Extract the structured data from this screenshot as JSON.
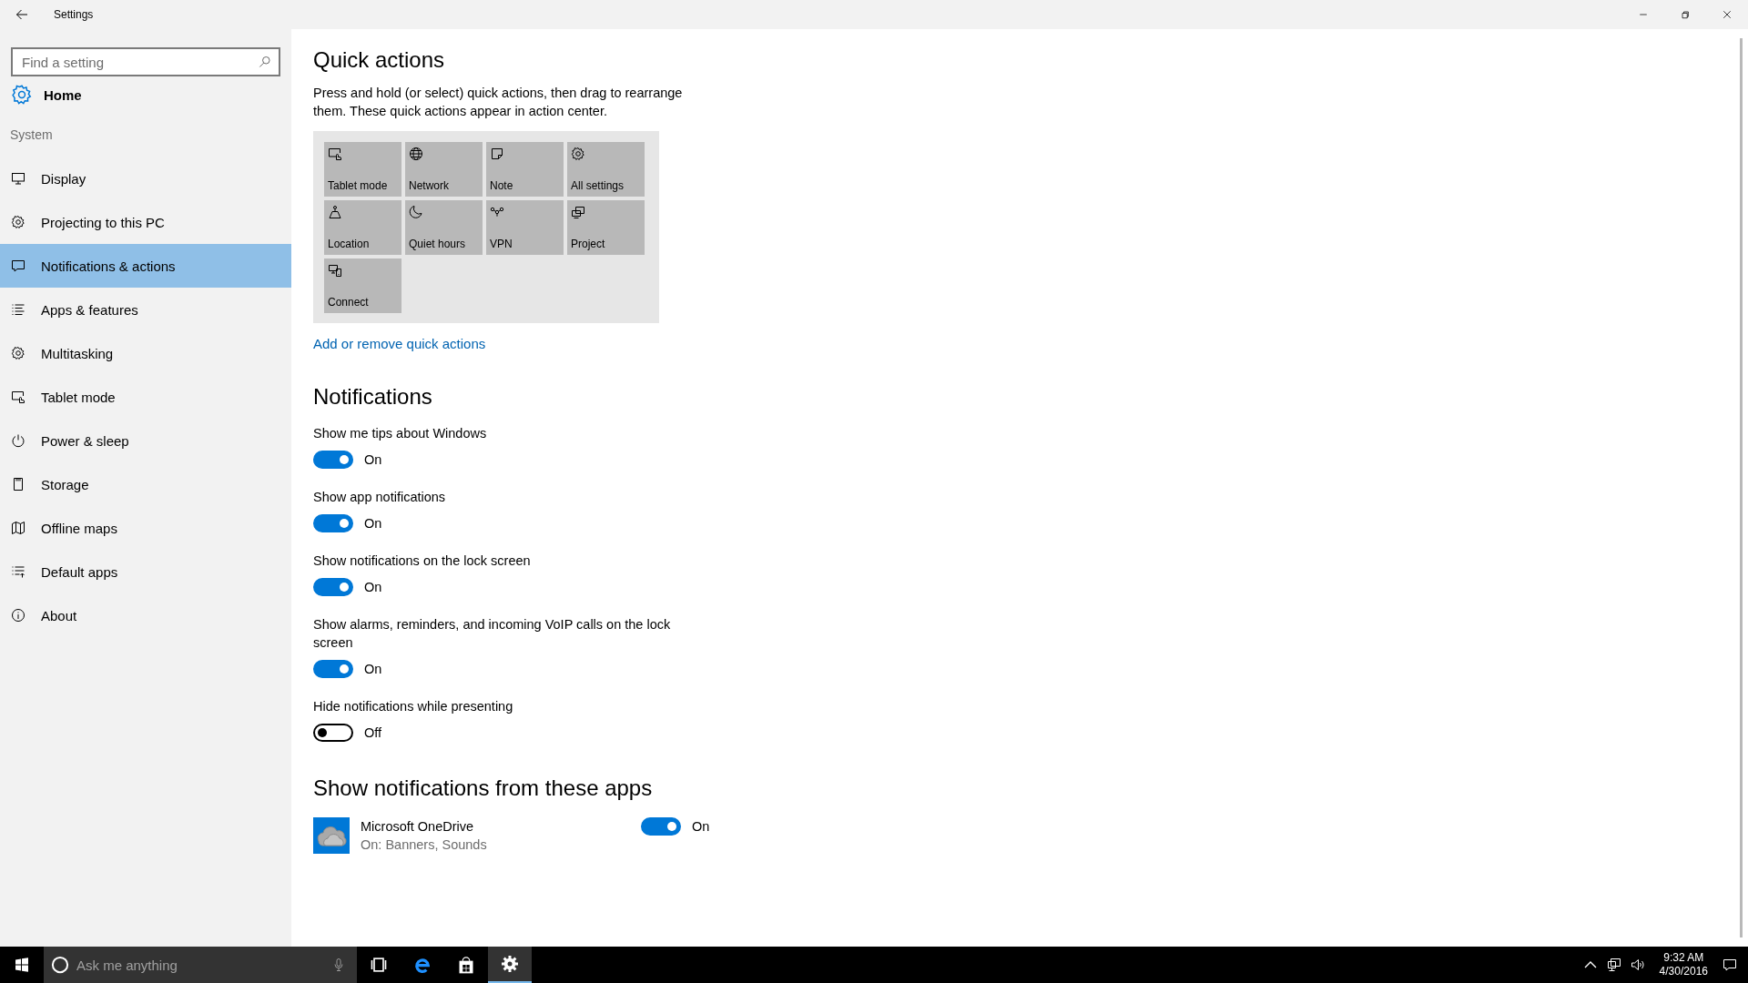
{
  "window": {
    "title": "Settings"
  },
  "search": {
    "placeholder": "Find a setting"
  },
  "home": {
    "label": "Home"
  },
  "sidebar": {
    "section": "System",
    "items": [
      {
        "label": "Display",
        "selected": false
      },
      {
        "label": "Projecting to this PC",
        "selected": false
      },
      {
        "label": "Notifications & actions",
        "selected": true
      },
      {
        "label": "Apps & features",
        "selected": false
      },
      {
        "label": "Multitasking",
        "selected": false
      },
      {
        "label": "Tablet mode",
        "selected": false
      },
      {
        "label": "Power & sleep",
        "selected": false
      },
      {
        "label": "Storage",
        "selected": false
      },
      {
        "label": "Offline maps",
        "selected": false
      },
      {
        "label": "Default apps",
        "selected": false
      },
      {
        "label": "About",
        "selected": false
      }
    ]
  },
  "quick_actions": {
    "title": "Quick actions",
    "description": "Press and hold (or select) quick actions, then drag to rearrange them. These quick actions appear in action center.",
    "tiles": [
      {
        "label": "Tablet mode"
      },
      {
        "label": "Network"
      },
      {
        "label": "Note"
      },
      {
        "label": "All settings"
      },
      {
        "label": "Location"
      },
      {
        "label": "Quiet hours"
      },
      {
        "label": "VPN"
      },
      {
        "label": "Project"
      },
      {
        "label": "Connect"
      }
    ],
    "link": "Add or remove quick actions"
  },
  "notifications": {
    "title": "Notifications",
    "settings": [
      {
        "label": "Show me tips about Windows",
        "on": true,
        "state_text": "On"
      },
      {
        "label": "Show app notifications",
        "on": true,
        "state_text": "On"
      },
      {
        "label": "Show notifications on the lock screen",
        "on": true,
        "state_text": "On"
      },
      {
        "label": "Show alarms, reminders, and incoming VoIP calls on the lock screen",
        "on": true,
        "state_text": "On"
      },
      {
        "label": "Hide notifications while presenting",
        "on": false,
        "state_text": "Off"
      }
    ]
  },
  "apps_section": {
    "title": "Show notifications from these apps",
    "apps": [
      {
        "name": "Microsoft OneDrive",
        "detail": "On: Banners, Sounds",
        "on": true,
        "state_text": "On"
      }
    ]
  },
  "taskbar": {
    "search_placeholder": "Ask me anything",
    "pinned": [
      {
        "selected": false
      },
      {
        "selected": false
      },
      {
        "selected": false
      },
      {
        "selected": true
      }
    ],
    "clock": {
      "time": "9:32 AM",
      "date": "4/30/2016"
    }
  }
}
